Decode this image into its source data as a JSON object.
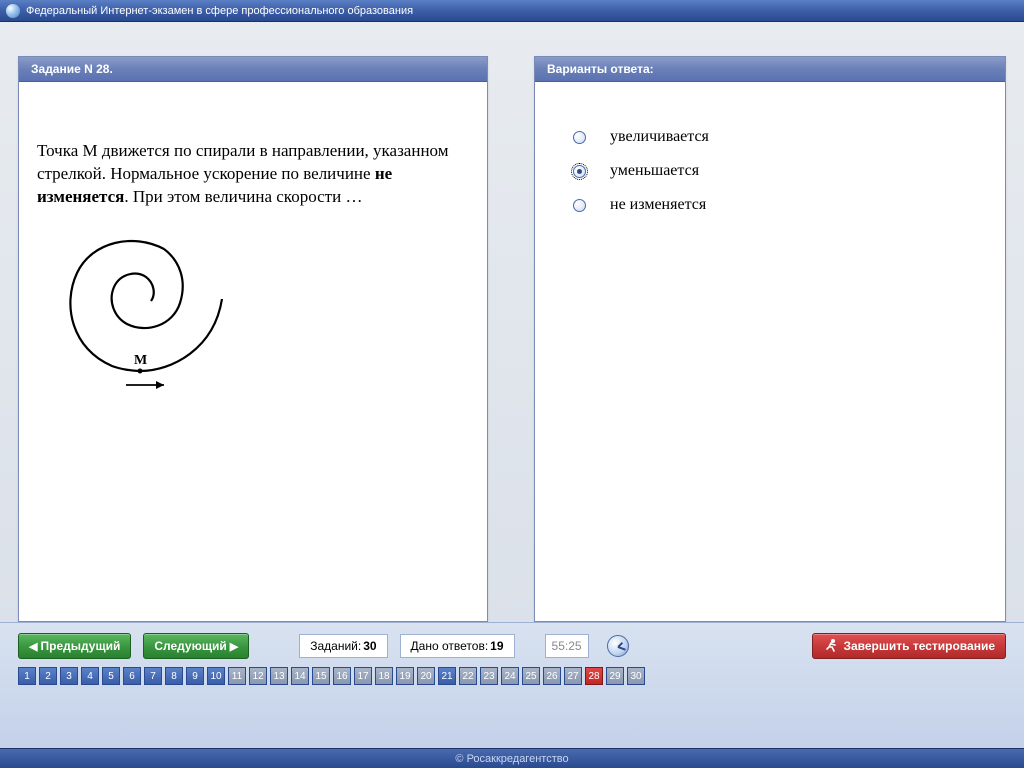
{
  "app_title": "Федеральный Интернет-экзамен в сфере профессионального образования",
  "question": {
    "header": "Задание N 28.",
    "text_before_bold": "Точка M движется по спирали в направлении, указанном стрелкой. Нормальное ускорение по величине ",
    "text_bold": "не изменяется",
    "text_after_bold": ". При этом величина скорости …",
    "point_label": "M"
  },
  "answers": {
    "header": "Варианты ответа:",
    "options": [
      {
        "label": "увеличивается",
        "selected": false
      },
      {
        "label": "уменьшается",
        "selected": true
      },
      {
        "label": "не изменяется",
        "selected": false
      }
    ]
  },
  "nav": {
    "prev": "Предыдущий",
    "next": "Следующий",
    "total_label": "Заданий:",
    "total_value": "30",
    "answered_label": "Дано ответов:",
    "answered_value": "19",
    "timer": "55:25",
    "finish": "Завершить тестирование"
  },
  "grid": {
    "count": 30,
    "gray": [
      11,
      12,
      13,
      14,
      15,
      16,
      17,
      18,
      19,
      20,
      22,
      23,
      24,
      25,
      26,
      27,
      29,
      30
    ],
    "red": [
      28
    ]
  },
  "footer": "© Росаккредагентство"
}
